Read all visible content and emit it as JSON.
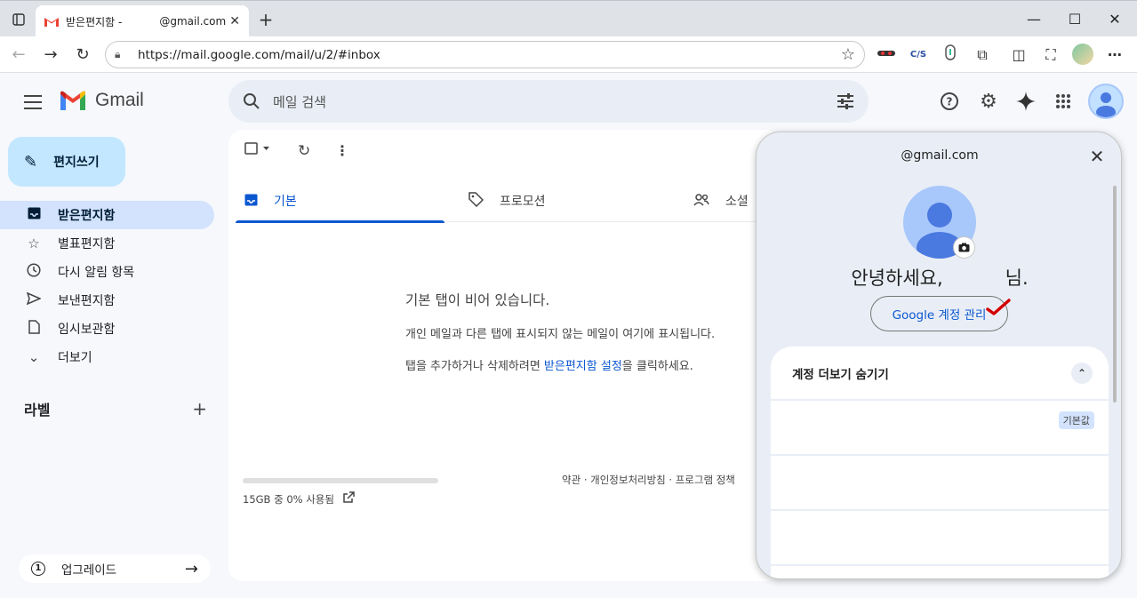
{
  "browser": {
    "tab_title": "받은편지함 -",
    "tab_title_email": "@gmail.com",
    "tab_close": "✕",
    "new_tab": "+",
    "url": "https://mail.google.com/mail/u/2/#inbox",
    "ext_cjs": "C/S"
  },
  "gmail": {
    "logo_text": "Gmail",
    "search_placeholder": "메일 검색",
    "compose_label": "편지쓰기",
    "nav": [
      {
        "label": "받은편지함",
        "icon": "inbox-icon"
      },
      {
        "label": "별표편지함",
        "icon": "star-icon"
      },
      {
        "label": "다시 알림 항목",
        "icon": "clock-icon"
      },
      {
        "label": "보낸편지함",
        "icon": "send-icon"
      },
      {
        "label": "임시보관함",
        "icon": "draft-icon"
      },
      {
        "label": "더보기",
        "icon": "chevron-down-icon"
      }
    ],
    "labels_title": "라벨",
    "upgrade_label": "업그레이드",
    "tabs": [
      {
        "label": "기본"
      },
      {
        "label": "프로모션"
      },
      {
        "label": "소셜"
      }
    ],
    "empty_title": "기본 탭이 비어 있습니다.",
    "empty_line1": "개인 메일과 다른 탭에 표시되지 않는 메일이 여기에 표시됩니다.",
    "empty_line2_pre": "탭을 추가하거나 삭제하려면 ",
    "empty_line2_link": "받은편지함 설정",
    "empty_line2_post": "을 클릭하세요.",
    "storage_text": "15GB 중 0% 사용됨",
    "storage_used_fraction": 0,
    "footer_links": "약관 · 개인정보처리방침 · 프로그램 정책"
  },
  "account_panel": {
    "email": "@gmail.com",
    "greeting_pre": "안녕하세요,",
    "greeting_post": "님.",
    "manage_button": "Google 계정 관리",
    "more_accounts_label": "계정 더보기 숨기기",
    "default_badge": "기본값"
  },
  "colors": {
    "accent": "#0b57d0",
    "compose_bg": "#c2e7ff",
    "nav_active_bg": "#d3e3fd",
    "app_bg": "#f6f8fc"
  }
}
